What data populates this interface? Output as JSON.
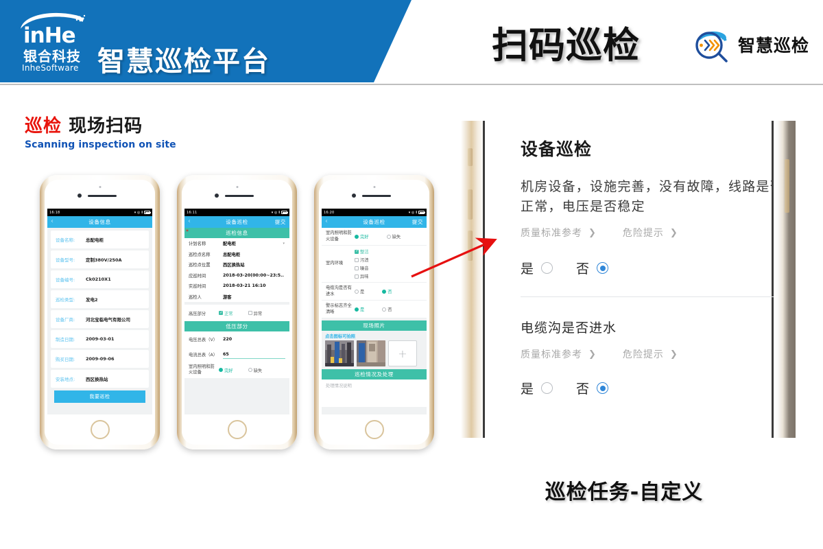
{
  "header": {
    "logo_brand": "inHe",
    "logo_cn": "银合科技",
    "logo_en": "InheSoftware",
    "platform_title": "智慧巡检平台",
    "page_heading": "扫码巡检",
    "brand_right": "智慧巡检"
  },
  "section": {
    "title_red": "巡检",
    "title_black": "现场扫码",
    "subtitle_en": "Scanning inspection on site"
  },
  "footer": {
    "caption": "巡检任务-自定义"
  },
  "phone1": {
    "status_time": "16:18",
    "nav_title": "设备信息",
    "back_icon": "chevron-left-icon",
    "rows": [
      {
        "key": "设备名称:",
        "value": "总配电柜"
      },
      {
        "key": "设备型号:",
        "value": "定制380V/250A"
      },
      {
        "key": "设备编号:",
        "value": "Ck0210X1"
      },
      {
        "key": "巡检类型:",
        "value": "发电2"
      },
      {
        "key": "设备厂商:",
        "value": "河北宝临电气有限公司"
      },
      {
        "key": "制造日期:",
        "value": "2009-03-01"
      },
      {
        "key": "购买日期:",
        "value": "2009-09-06"
      },
      {
        "key": "安装地点:",
        "value": "西区换热站"
      }
    ],
    "action_button": "我要巡检"
  },
  "phone2": {
    "status_time": "16:11",
    "nav_title": "设备巡检",
    "nav_action": "提交",
    "section_header": "巡检信息",
    "required_mark": "*",
    "rows": [
      {
        "key": "计划名称",
        "value": "配电柜",
        "caret": true
      },
      {
        "key": "巡检点名称",
        "value": "总配电柜",
        "caret": false
      },
      {
        "key": "巡检点位置",
        "value": "西区换热站",
        "caret": false
      },
      {
        "key": "应巡时间",
        "value": "2018-03-20(00:00~23:5..",
        "caret": false
      },
      {
        "key": "实巡时间",
        "value": "2018-03-21 16:10",
        "caret": false
      },
      {
        "key": "巡检人",
        "value": "游客",
        "caret": false
      }
    ],
    "hv_label": "高压部分",
    "hv_options": [
      {
        "label": "正常",
        "checked": true
      },
      {
        "label": "异常",
        "checked": false
      }
    ],
    "lv_header": "低压部分",
    "lv_fields": [
      {
        "label": "电压总表（V）",
        "value": "220",
        "underline": false
      },
      {
        "label": "电流总表（A）",
        "value": "65",
        "underline": true
      }
    ],
    "light_label": "室内照明和防火设备",
    "light_options": [
      {
        "label": "完好",
        "checked": true
      },
      {
        "label": "缺失",
        "checked": false
      }
    ]
  },
  "phone3": {
    "status_time": "16:20",
    "nav_title": "设备巡检",
    "nav_action": "提交",
    "q_light": {
      "label": "室内照明和防火设备",
      "options": [
        {
          "label": "完好",
          "checked": true
        },
        {
          "label": "缺失",
          "checked": false
        }
      ]
    },
    "q_env": {
      "label": "室内环境",
      "options": [
        {
          "label": "整洁",
          "checked": true
        },
        {
          "label": "污渍",
          "checked": false
        },
        {
          "label": "噪音",
          "checked": false
        },
        {
          "label": "异味",
          "checked": false
        }
      ]
    },
    "q_water": {
      "label": "电缆沟是否有进水",
      "options": [
        {
          "label": "是",
          "checked": false
        },
        {
          "label": "否",
          "checked": true
        }
      ]
    },
    "q_sign": {
      "label": "警示标志齐全清晰",
      "options": [
        {
          "label": "是",
          "checked": true
        },
        {
          "label": "否",
          "checked": false
        }
      ]
    },
    "photo_header": "现场照片",
    "photo_hint": "点击图标可拍照",
    "add_photo_icon": "plus-icon",
    "result_header": "巡检情况及处理",
    "result_placeholder": "处理情况说明"
  },
  "big_panel": {
    "title": "设备巡检",
    "question1": "机房设备，设施完善，没有故障，线路是否正常，电压是否稳定",
    "link_quality": "质量标准参考",
    "link_risk": "危险提示",
    "chevron": "›",
    "yes_label": "是",
    "no_label": "否",
    "q1_selected": "否",
    "question2": "电缆沟是否进水",
    "q2_selected": "否"
  },
  "colors": {
    "header_blue": "#1272ba",
    "nav_blue": "#31b5e8",
    "section_teal": "#3ec0a8",
    "accent_red": "#e8140c",
    "radio_blue": "#2f86d8",
    "link_gray": "#a8a8a8"
  }
}
